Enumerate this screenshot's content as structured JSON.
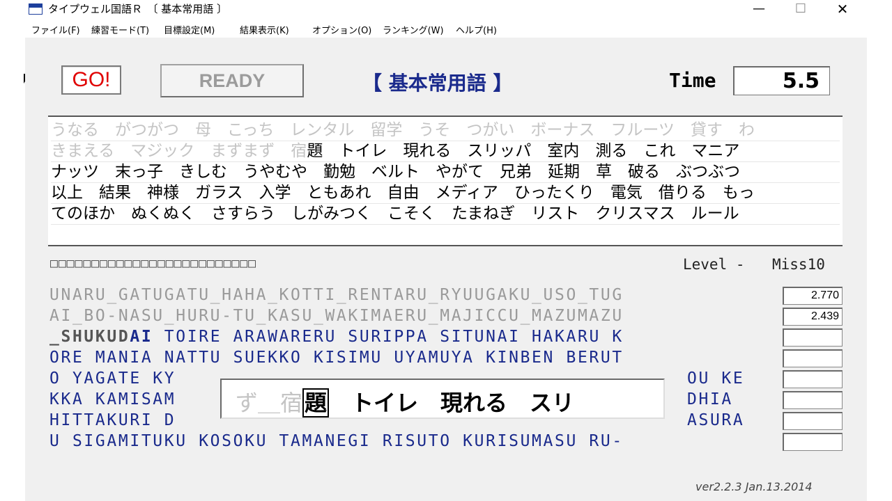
{
  "window": {
    "title": "タイプウェル国語Ｒ　〔 基本常用語 〕"
  },
  "menu": [
    "ファイル(F)",
    "練習モード(T)",
    "目標設定(M)",
    "結果表示(K)",
    "オプション(O)",
    "ランキング(W)",
    "ヘルプ(H)"
  ],
  "controls": {
    "go_label": "GO!",
    "ready_label": "READY"
  },
  "mode_title": "【 基本常用語 】",
  "time": {
    "label": "Time",
    "value": "5.5"
  },
  "japanese_lines": [
    {
      "gray": "うなる　がつがつ　母　こっち　レンタル　留学　うそ　つがい　ボーナス　フルーツ　貸す　わ",
      "rest": ""
    },
    {
      "gray": "きまえる　マジック　まずまず　宿",
      "rest": "題　トイレ　現れる　スリッパ　室内　測る　これ　マニア"
    },
    {
      "gray": "",
      "rest": "ナッツ　末っ子　きしむ　うやむや　勤勉　ベルト　やがて　兄弟　延期　草　破る　ぶつぶつ"
    },
    {
      "gray": "",
      "rest": "以上　結果　神様　ガラス　入学　ともあれ　自由　メディア　ひったくり　電気　借りる　もっ"
    },
    {
      "gray": "",
      "rest": "てのほか　ぬくぬく　さすらう　しがみつく　こそく　たまねぎ　リスト　クリスマス　ルール"
    }
  ],
  "progress_boxes": "□□□□□□□□□□□□□□□□□□□□□□□□□",
  "level": "Level -",
  "miss": "Miss10",
  "romaji": {
    "line1": "UNARU_GATUGATU_HAHA_KOTTI_RENTARU_RYUUGAKU_USO_TUG",
    "line2": "AI_BO-NASU_HURU-TU_KASU_WAKIMAERU_MAJICCU_MAZUMAZU",
    "line3_typed": "_SHUKUD",
    "line3_cur": "AI",
    "line3_rest": " TOIRE ARAWARERU SURIPPA SITUNAI HAKARU K",
    "line4": "ORE MANIA NATTU SUEKKO KISIMU UYAMUYA KINBEN BERUT",
    "line5a": "O YAGATE KY",
    "line5b": "OU KE",
    "line6a": "KKA KAMISAM",
    "line6b": "DHIA",
    "line7a": "HITTAKURI D",
    "line7b": "ASURA",
    "line8": "U SIGAMITUKU KOSOKU TAMANEGI RISUTO KURISUMASU RU-"
  },
  "scores": [
    "2.770",
    "2.439",
    "",
    "",
    "",
    "",
    "",
    ""
  ],
  "input": {
    "prev": "ず＿宿",
    "current": "題",
    "next": "　トイレ　現れる　スリ"
  },
  "version": "ver2.2.3 Jan.13.2014"
}
